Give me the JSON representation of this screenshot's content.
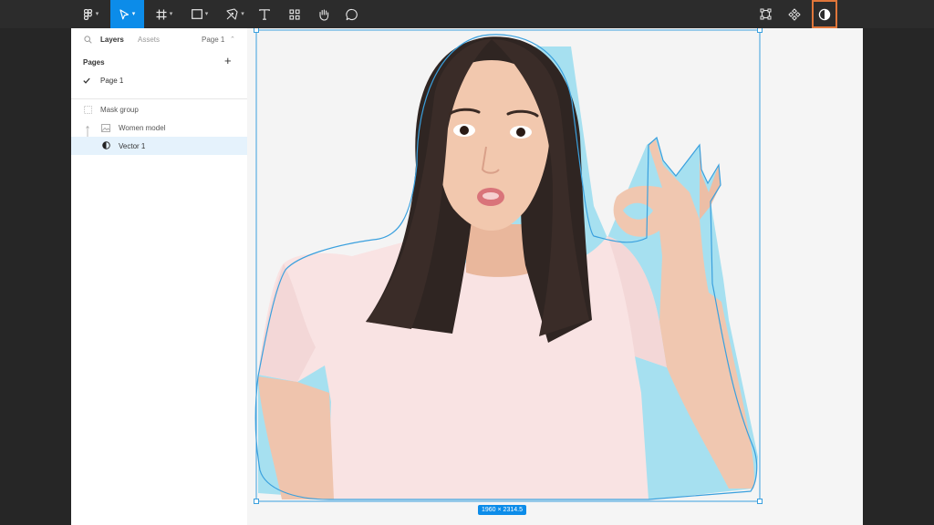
{
  "toolbar": {
    "tools": [
      {
        "name": "main-menu",
        "icon": "figma-logo-icon",
        "has_dropdown": true
      },
      {
        "name": "move-tool",
        "icon": "cursor-arrow-icon",
        "has_dropdown": true,
        "active": true
      },
      {
        "name": "frame-tool",
        "icon": "frame-hash-icon",
        "has_dropdown": true
      },
      {
        "name": "shape-tool",
        "icon": "rectangle-icon",
        "has_dropdown": true
      },
      {
        "name": "pen-tool",
        "icon": "pen-nib-icon",
        "has_dropdown": true
      },
      {
        "name": "text-tool",
        "icon": "text-t-icon"
      },
      {
        "name": "resources-tool",
        "icon": "resources-icon"
      },
      {
        "name": "hand-tool",
        "icon": "hand-icon"
      },
      {
        "name": "comment-tool",
        "icon": "comment-bubble-icon"
      }
    ],
    "right_tools": [
      {
        "name": "crop-tool",
        "icon": "crop-frame-icon"
      },
      {
        "name": "component-tool",
        "icon": "component-diamond-icon"
      },
      {
        "name": "mask-tool",
        "icon": "mask-half-circle-icon",
        "highlighted": true
      }
    ],
    "accent_color": "#0c8ce9",
    "highlight_color": "#e0763a"
  },
  "panel": {
    "tabs": {
      "layers": "Layers",
      "assets": "Assets"
    },
    "page_selector": "Page 1",
    "pages_title": "Pages",
    "pages": [
      {
        "label": "Page 1",
        "current": true
      }
    ],
    "layers": [
      {
        "label": "Mask group",
        "icon": "mask-group-icon",
        "depth": 0,
        "selected": false
      },
      {
        "label": "Women model",
        "icon": "image-icon",
        "depth": 1,
        "selected": false
      },
      {
        "label": "Vector 1",
        "icon": "vector-mask-icon",
        "depth": 1,
        "selected": true
      }
    ]
  },
  "canvas": {
    "dimensions_label": "1960 × 2314.5",
    "selection_color": "#3aa0de"
  }
}
